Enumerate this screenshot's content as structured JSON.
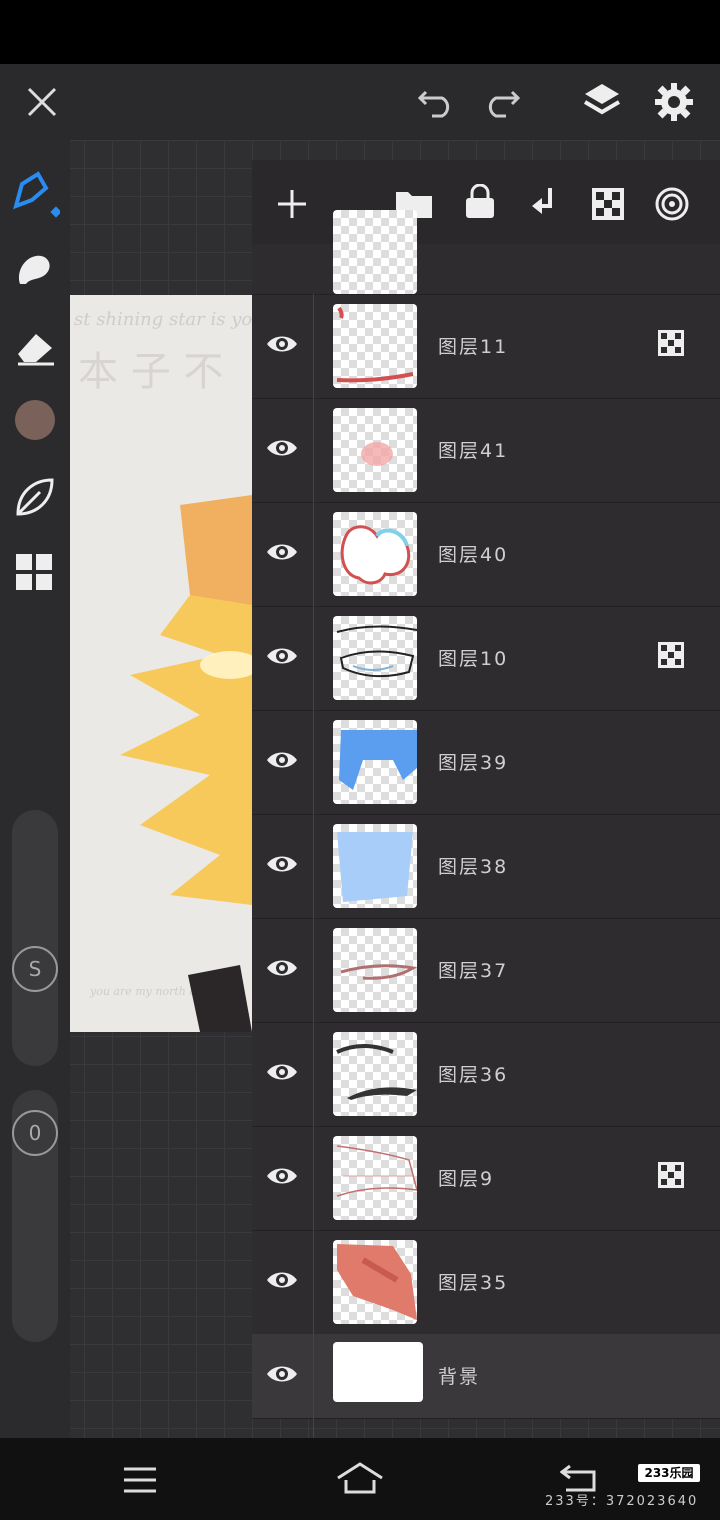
{
  "topbar": {
    "close": "close-icon",
    "undo": "undo-icon",
    "redo": "redo-icon",
    "layers": "layers-icon",
    "settings": "gear-icon"
  },
  "tools": [
    {
      "name": "pen-icon"
    },
    {
      "name": "smudge-icon"
    },
    {
      "name": "eraser-icon"
    },
    {
      "name": "color-swatch",
      "color": "#7a625b"
    },
    {
      "name": "leaf-icon"
    },
    {
      "name": "grid-icon"
    }
  ],
  "sliders": {
    "size_label": "S",
    "opacity_label": "0"
  },
  "layer_panel": {
    "actions": [
      "add-icon",
      "folder-icon",
      "lock-icon",
      "merge-down-icon",
      "checker-icon",
      "target-icon"
    ],
    "layers": [
      {
        "name": "图层11",
        "clipped": true
      },
      {
        "name": "图层41",
        "clipped": false
      },
      {
        "name": "图层40",
        "clipped": false
      },
      {
        "name": "图层10",
        "clipped": true
      },
      {
        "name": "图层39",
        "clipped": false
      },
      {
        "name": "图层38",
        "clipped": false
      },
      {
        "name": "图层37",
        "clipped": false
      },
      {
        "name": "图层36",
        "clipped": false
      },
      {
        "name": "图层9",
        "clipped": true
      },
      {
        "name": "图层35",
        "clipped": false
      },
      {
        "name": "背景",
        "clipped": false
      }
    ]
  },
  "navbar": {
    "menu": "menu-icon",
    "home": "home-icon",
    "back": "back-icon"
  },
  "watermark": {
    "brand": "233乐园",
    "text": "233号：372023640"
  }
}
